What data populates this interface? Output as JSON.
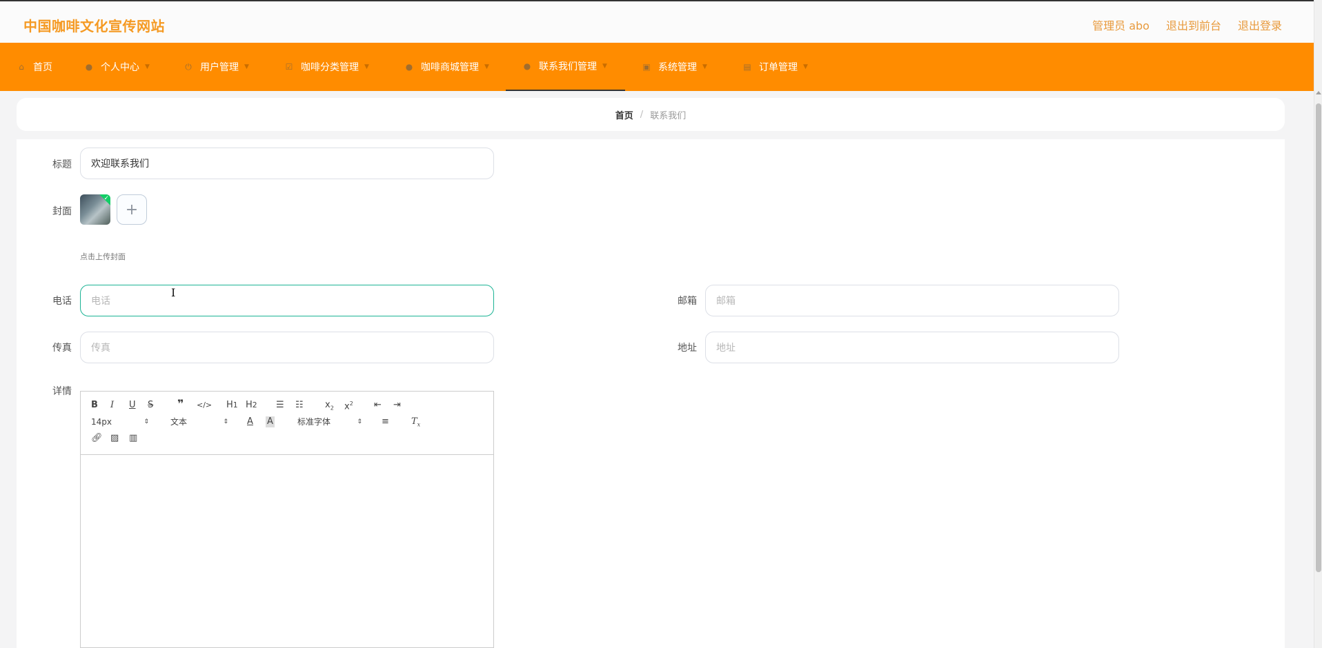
{
  "header": {
    "site_title": "中国咖啡文化宣传网站",
    "admin_label": "管理员 abo",
    "front_label": "退出到前台",
    "logout_label": "退出登录"
  },
  "nav": {
    "items": [
      {
        "label": "首页",
        "icon": "home-icon"
      },
      {
        "label": "个人中心",
        "icon": "user-icon"
      },
      {
        "label": "用户管理",
        "icon": "power-icon"
      },
      {
        "label": "咖啡分类管理",
        "icon": "checkbox-icon"
      },
      {
        "label": "咖啡商城管理",
        "icon": "location-icon"
      },
      {
        "label": "联系我们管理",
        "icon": "chat-icon"
      },
      {
        "label": "系统管理",
        "icon": "cart-icon"
      },
      {
        "label": "订单管理",
        "icon": "shop-icon"
      }
    ],
    "active": "联系我们管理"
  },
  "breadcrumb": {
    "home": "首页",
    "separator": "/",
    "current": "联系我们"
  },
  "form": {
    "title_label": "标题",
    "title_value": "欢迎联系我们",
    "cover_label": "封面",
    "cover_hint": "点击上传封面",
    "cover_add_symbol": "+",
    "phone_label": "电话",
    "phone_placeholder": "电话",
    "email_label": "邮箱",
    "email_placeholder": "邮箱",
    "fax_label": "传真",
    "fax_placeholder": "传真",
    "address_label": "地址",
    "address_placeholder": "地址",
    "detail_label": "详情"
  },
  "editor": {
    "size_select": "14px",
    "format_select": "文本",
    "font_select": "标准字体"
  },
  "colors": {
    "brand": "#f59a23",
    "nav_bg": "#ff8c00",
    "focus": "#1ab394"
  }
}
